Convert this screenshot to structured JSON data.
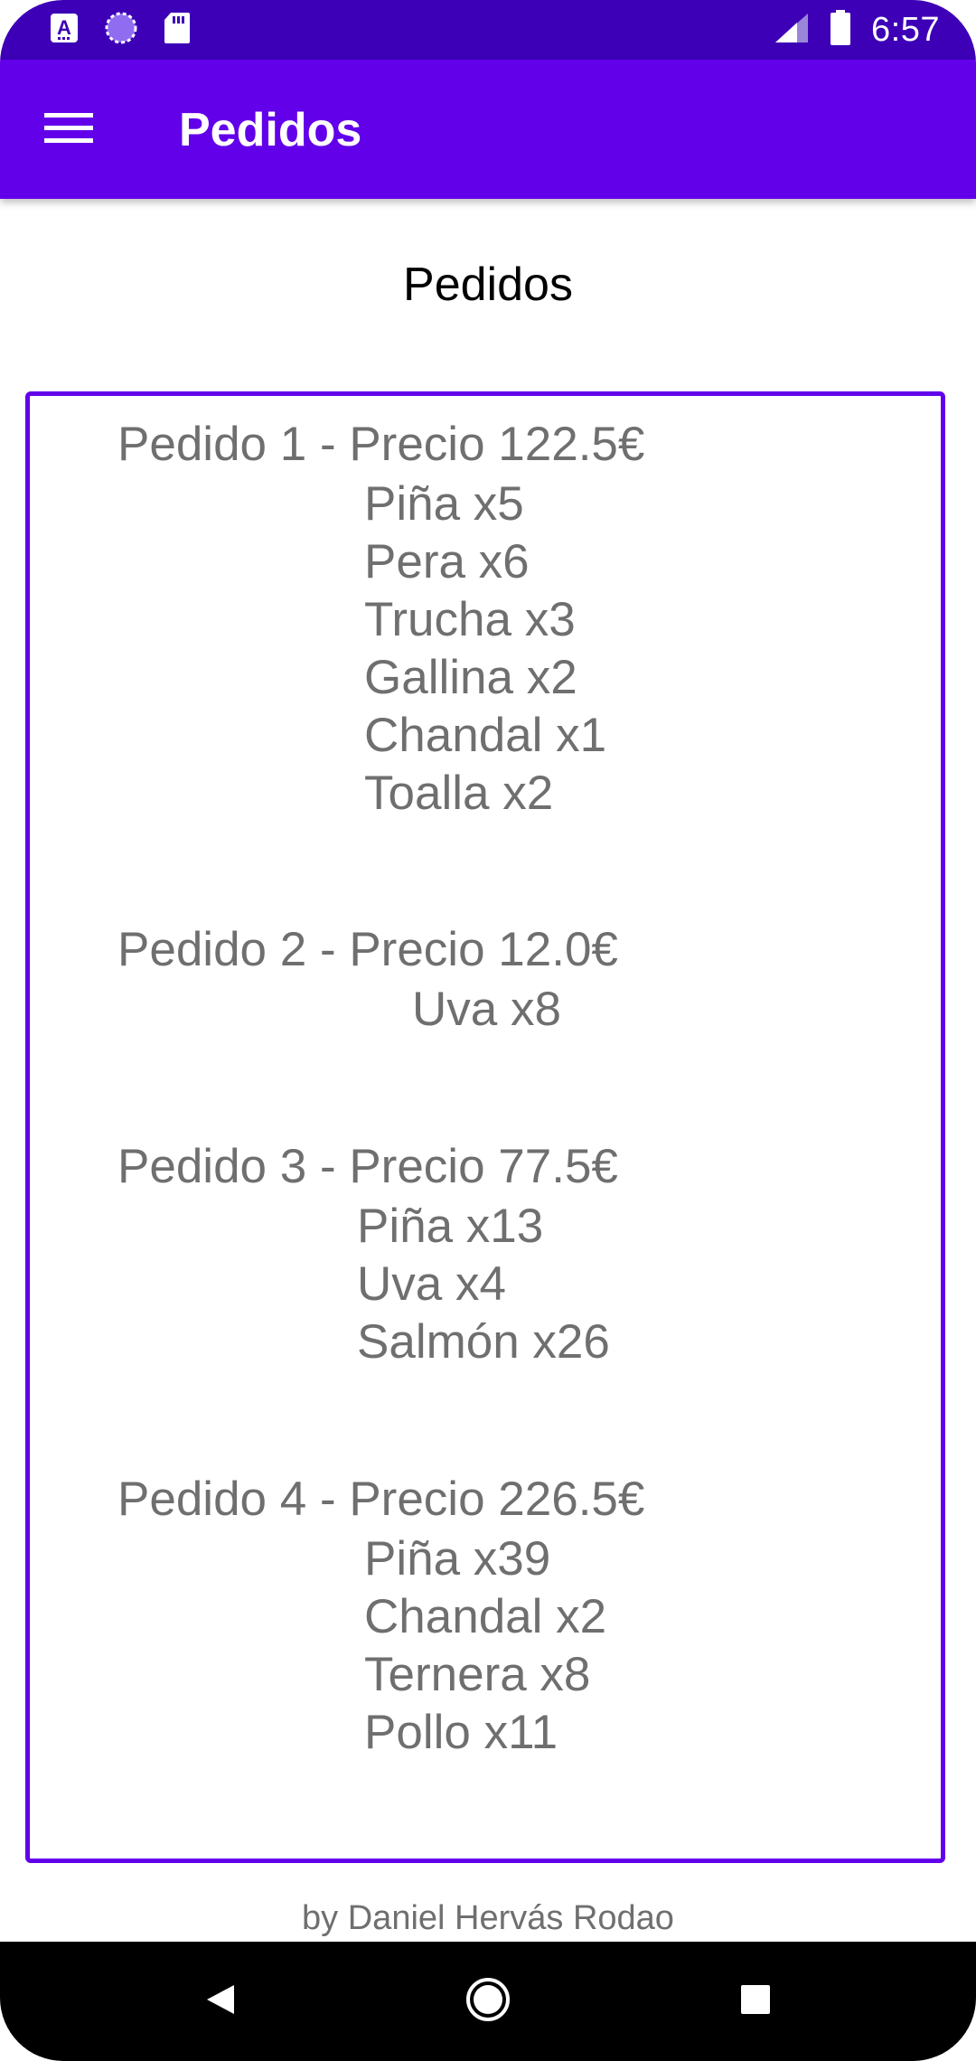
{
  "status_bar": {
    "time": "6:57",
    "left_icons": [
      "font-notification-icon",
      "loading-icon",
      "sd-card-icon"
    ],
    "right_icons": [
      "cellular-signal-icon",
      "battery-icon"
    ]
  },
  "app_bar": {
    "title": "Pedidos",
    "menu_icon": "hamburger-menu-icon",
    "color": "#6200ea"
  },
  "page": {
    "heading": "Pedidos",
    "orders": [
      {
        "title": "Pedido 1 - Precio 122.5€",
        "items": [
          "Piña x5",
          "Pera x6",
          "Trucha x3",
          "Gallina x2",
          "Chandal x1",
          "Toalla x2"
        ]
      },
      {
        "title": "Pedido 2 - Precio 12.0€",
        "items": [
          "Uva x8"
        ]
      },
      {
        "title": "Pedido 3 - Precio 77.5€",
        "items": [
          "Piña x13",
          "Uva x4",
          "Salmón x26"
        ]
      },
      {
        "title": "Pedido 4 - Precio 226.5€",
        "items": [
          "Piña x39",
          "Chandal x2",
          "Ternera x8",
          "Pollo x11"
        ]
      }
    ],
    "credit": "by Daniel Hervás Rodao"
  },
  "nav_bar": {
    "buttons": [
      "back-icon",
      "home-icon",
      "recents-icon"
    ]
  },
  "colors": {
    "status_bar": "#3d00b7",
    "primary": "#6200ea",
    "text_secondary": "#6f6f6f"
  }
}
